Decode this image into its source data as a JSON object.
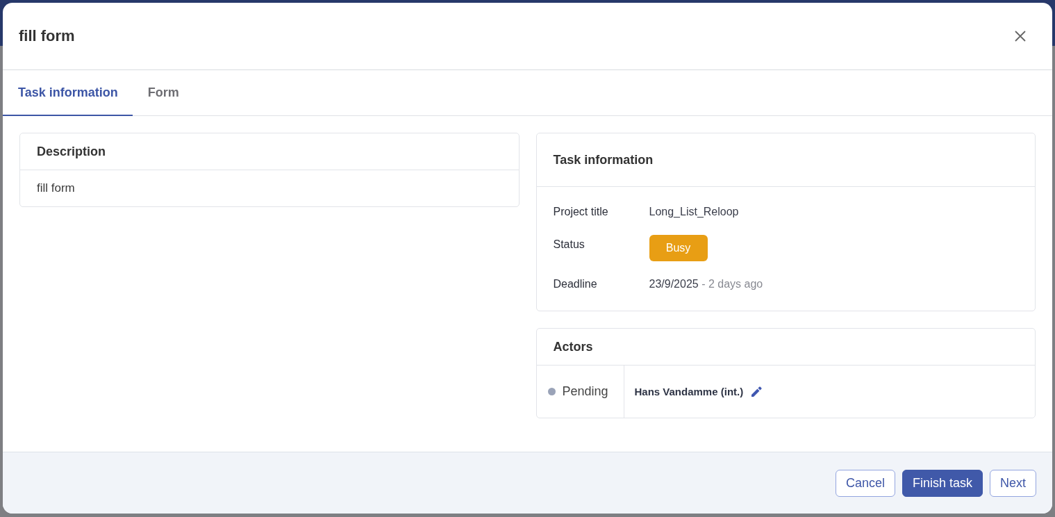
{
  "dialog": {
    "title": "fill form"
  },
  "tabs": [
    {
      "label": "Task information",
      "selected": true
    },
    {
      "label": "Form",
      "selected": false
    }
  ],
  "description_card": {
    "title": "Description",
    "text": "fill form"
  },
  "task_info_card": {
    "title": "Task information",
    "fields": [
      {
        "kind": "text",
        "label": "Project title",
        "value": "Long_List_Reloop"
      },
      {
        "kind": "badge",
        "label": "Status",
        "value": "Busy"
      },
      {
        "kind": "date",
        "label": "Deadline",
        "value": "23/9/2025",
        "relative": "- 2 days ago"
      }
    ]
  },
  "actors_card": {
    "title": "Actors",
    "actors": [
      {
        "status": "Pending",
        "color": "#9aa3b8",
        "name": "Hans Vandamme (int.)"
      }
    ]
  },
  "footer": {
    "buttons": [
      {
        "label": "Cancel",
        "kind": "outline"
      },
      {
        "label": "Finish task",
        "kind": "primary"
      },
      {
        "label": "Next",
        "kind": "outline"
      }
    ]
  }
}
